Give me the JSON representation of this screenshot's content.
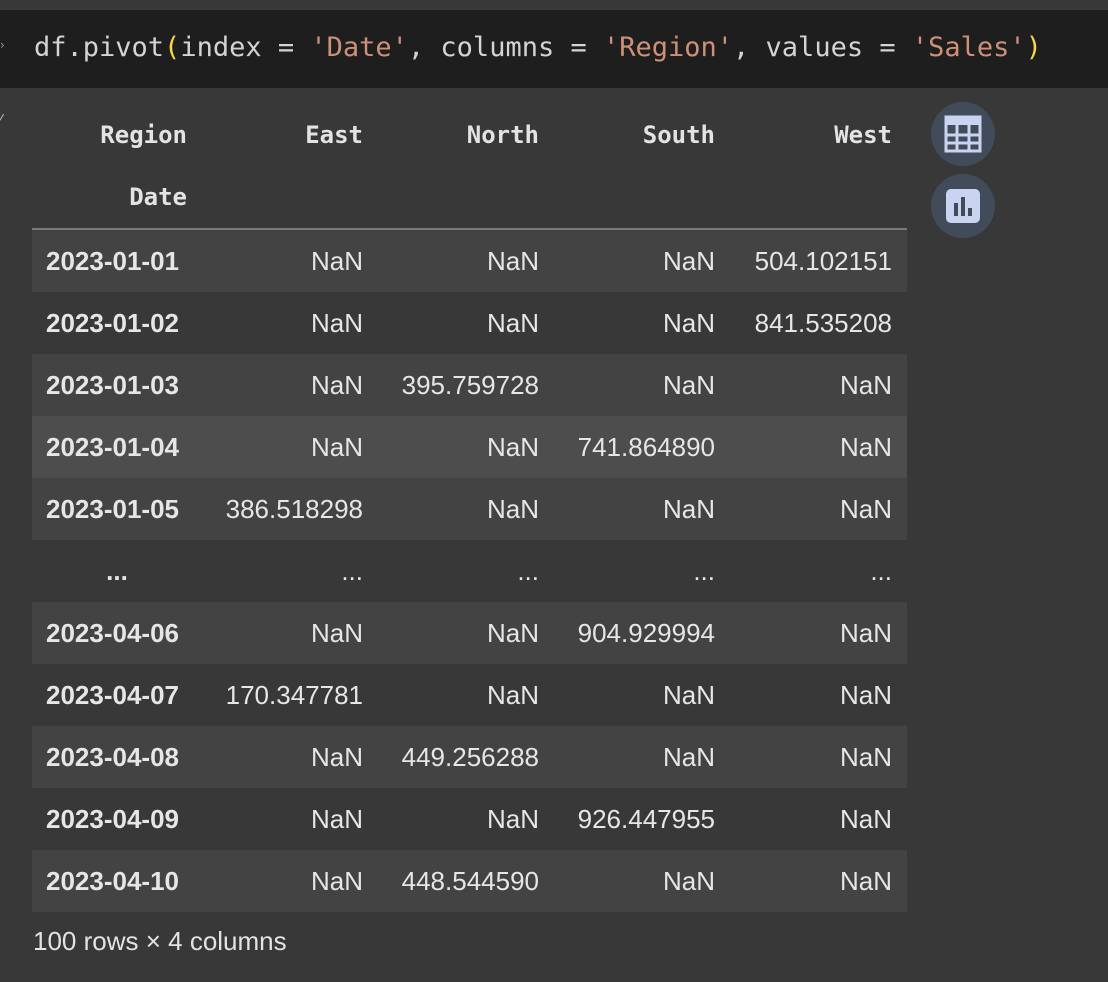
{
  "code": {
    "func": "df.pivot",
    "open_paren": "(",
    "arg1_key": "index = ",
    "arg1_val": "'Date'",
    "sep1": ", ",
    "arg2_key": "columns = ",
    "arg2_val": "'Region'",
    "sep2": ", ",
    "arg3_key": "values = ",
    "arg3_val": "'Sales'",
    "close_paren": ")"
  },
  "table": {
    "columns_name": "Region",
    "index_name": "Date",
    "columns": [
      "East",
      "North",
      "South",
      "West"
    ],
    "rows": [
      {
        "index": "2023-01-01",
        "values": [
          "NaN",
          "NaN",
          "NaN",
          "504.102151"
        ]
      },
      {
        "index": "2023-01-02",
        "values": [
          "NaN",
          "NaN",
          "NaN",
          "841.535208"
        ]
      },
      {
        "index": "2023-01-03",
        "values": [
          "NaN",
          "395.759728",
          "NaN",
          "NaN"
        ]
      },
      {
        "index": "2023-01-04",
        "values": [
          "NaN",
          "NaN",
          "741.864890",
          "NaN"
        ]
      },
      {
        "index": "2023-01-05",
        "values": [
          "386.518298",
          "NaN",
          "NaN",
          "NaN"
        ]
      },
      {
        "index": "...",
        "values": [
          "...",
          "...",
          "...",
          "..."
        ]
      },
      {
        "index": "2023-04-06",
        "values": [
          "NaN",
          "NaN",
          "904.929994",
          "NaN"
        ]
      },
      {
        "index": "2023-04-07",
        "values": [
          "170.347781",
          "NaN",
          "NaN",
          "NaN"
        ]
      },
      {
        "index": "2023-04-08",
        "values": [
          "NaN",
          "449.256288",
          "NaN",
          "NaN"
        ]
      },
      {
        "index": "2023-04-09",
        "values": [
          "NaN",
          "NaN",
          "926.447955",
          "NaN"
        ]
      },
      {
        "index": "2023-04-10",
        "values": [
          "NaN",
          "448.544590",
          "NaN",
          "NaN"
        ]
      }
    ]
  },
  "footer": "100 rows × 4 columns",
  "icons": {
    "table_button": "table-grid-icon",
    "chart_button": "bar-chart-icon"
  },
  "colors": {
    "code_bg": "#1e1e1e",
    "string": "#ce9178",
    "paren": "#f7d64a",
    "button_bg": "#424b59"
  }
}
